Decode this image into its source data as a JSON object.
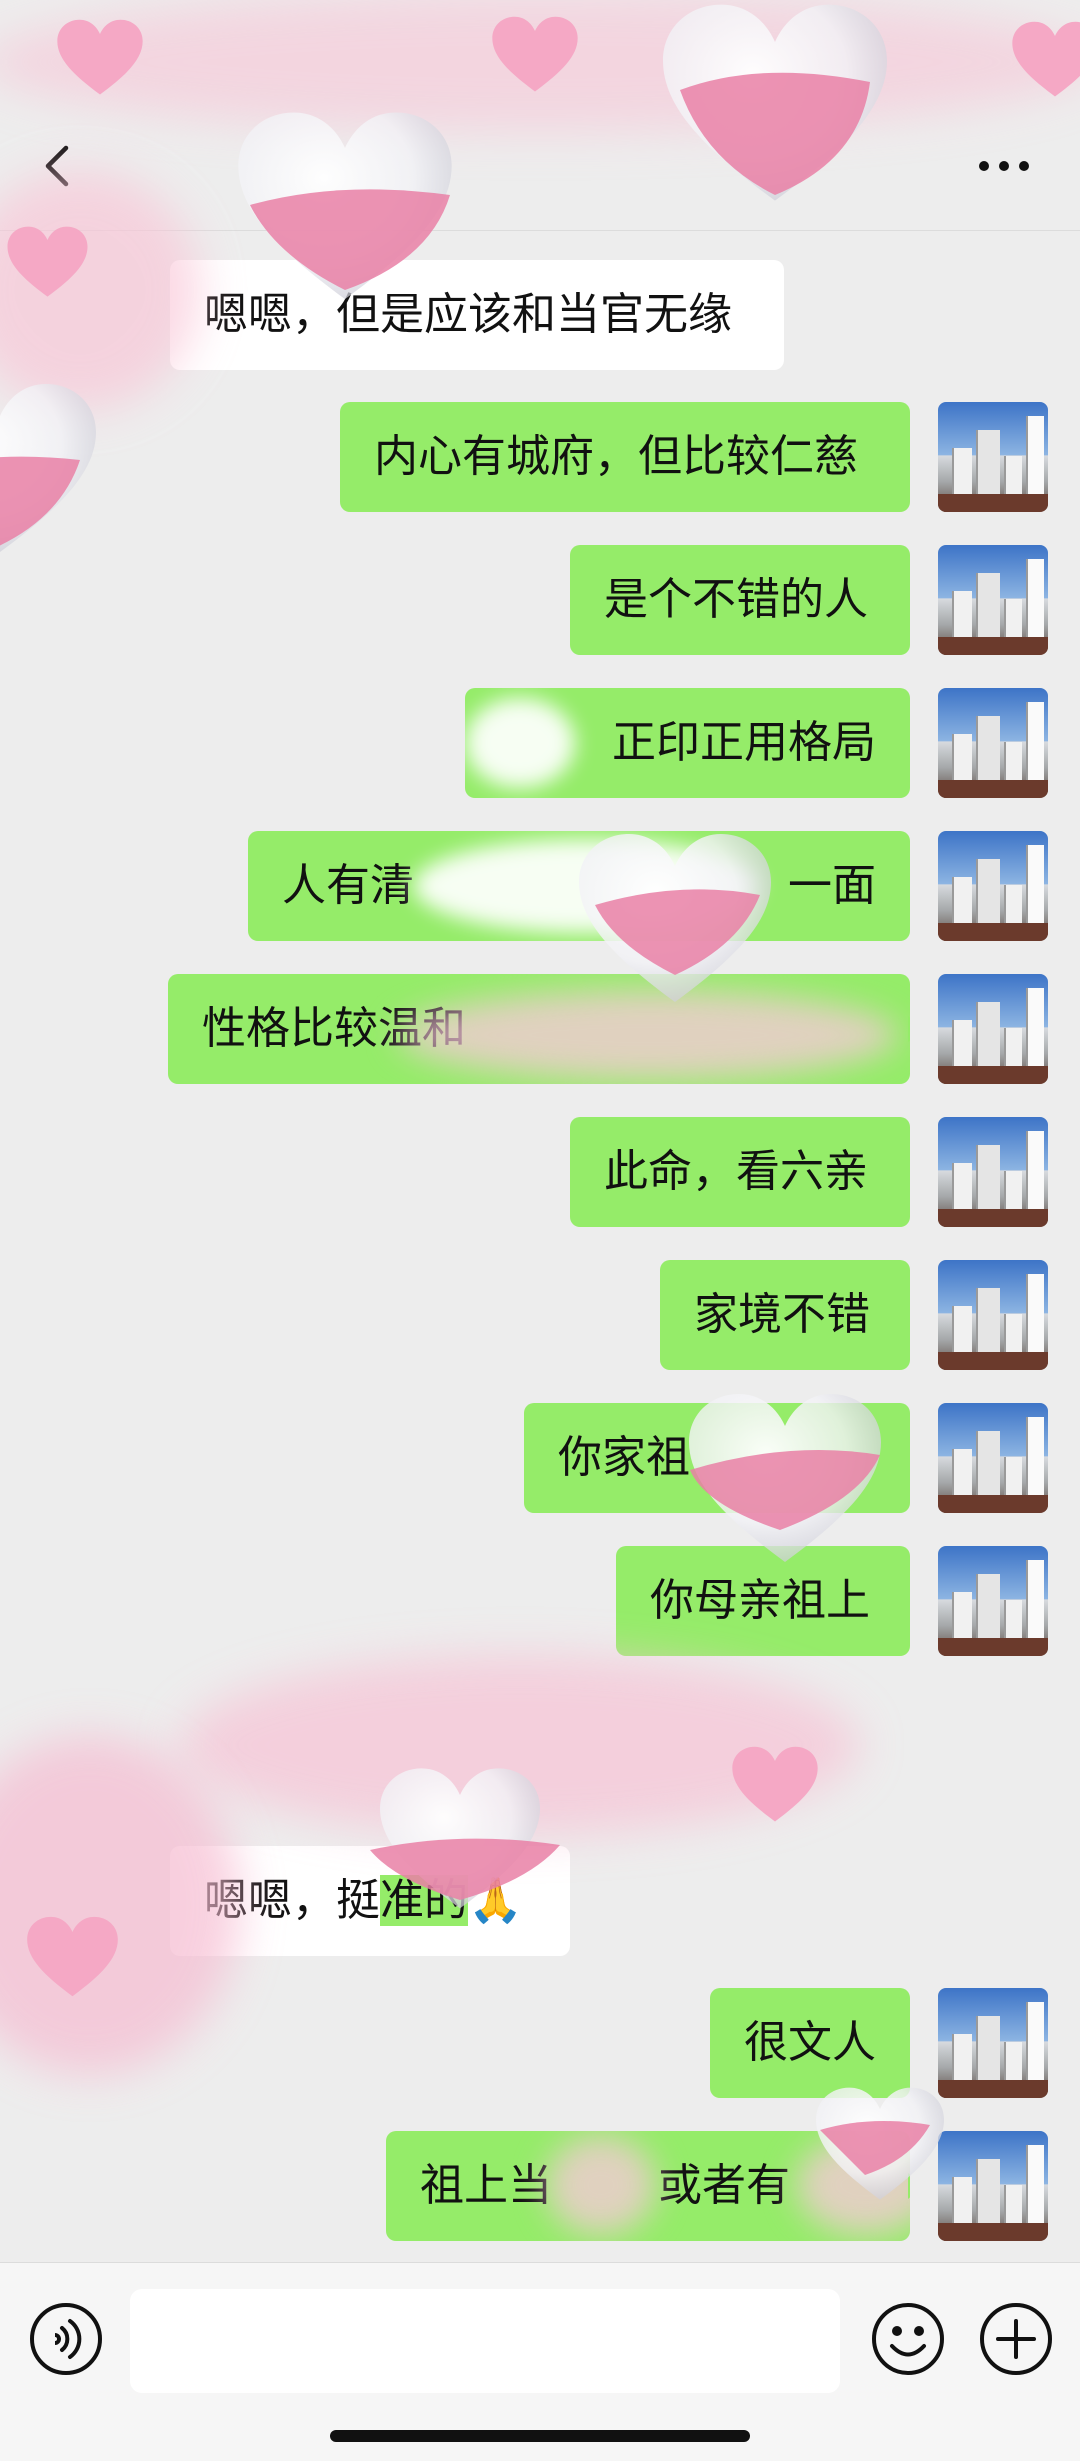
{
  "header": {
    "back_icon": "chevron-left-icon",
    "more_icon": "ellipsis-icon"
  },
  "messages": [
    {
      "side": "in",
      "text": "嗯嗯，但是应该和当官无缘"
    },
    {
      "side": "out",
      "text": "内心有城府，但比较仁慈"
    },
    {
      "side": "out",
      "text": "是个不错的人"
    },
    {
      "side": "out",
      "text": "正印正用格局"
    },
    {
      "side": "out",
      "text": "人有清"
    },
    {
      "side": "out",
      "text": "一面"
    },
    {
      "side": "out",
      "text": "性格比较温和"
    },
    {
      "side": "out",
      "text": "此命，看六亲"
    },
    {
      "side": "out",
      "text": "家境不错"
    },
    {
      "side": "out",
      "text": "你家祖"
    },
    {
      "side": "out",
      "text": "你母亲祖上"
    },
    {
      "side": "in",
      "text_parts": [
        "嗯嗯，挺",
        "准的",
        "🙏"
      ]
    },
    {
      "side": "out",
      "text": "很文人"
    },
    {
      "side": "out",
      "text": "祖上当"
    },
    {
      "side": "out",
      "text": "或者有"
    }
  ],
  "input_bar": {
    "voice_icon": "voice-icon",
    "emoji_icon": "emoji-icon",
    "plus_icon": "plus-icon",
    "input_value": ""
  },
  "colors": {
    "background": "#ededed",
    "outgoing_bubble": "#95ec69",
    "incoming_bubble": "#ffffff",
    "sticker_pink": "#f4a6c4"
  }
}
